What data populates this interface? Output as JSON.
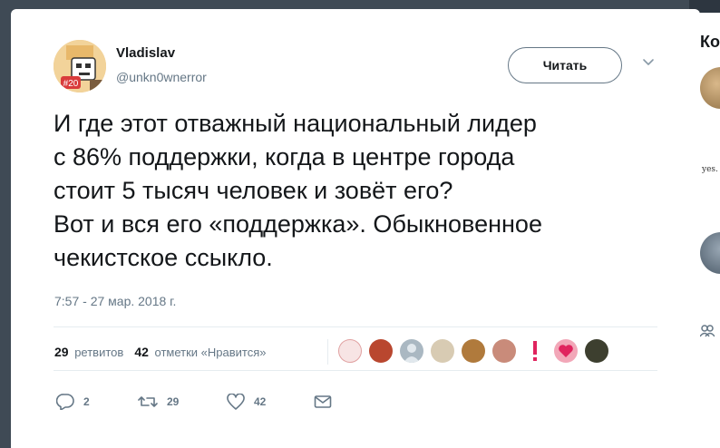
{
  "tweet": {
    "author_name": "Vladislav",
    "author_handle": "@unkn0wnerror",
    "avatar_badge": "#20",
    "follow_label": "Читать",
    "text": "И где этот отважный национальный лидер\nс 86% поддержки, когда в центре города\nстоит 5 тысяч человек и зовёт его?\nВот и вся его «поддержка». Обыкновенное\nчекистское ссыкло.",
    "timestamp": "7:57 - 27 мар. 2018 г.",
    "retweets_count": "29",
    "retweets_label": "ретвитов",
    "likes_count": "42",
    "likes_label": "отметки «Нравится»",
    "actions": {
      "reply_count": "2",
      "retweet_count": "29",
      "like_count": "42"
    },
    "liker_colors": [
      "#f3d6d6",
      "#c9523f",
      "#aab8c2",
      "#d8cbb3",
      "#b07a3c",
      "#c98b7a",
      "#e0245e",
      "#e85b7a",
      "#4a4f3a"
    ]
  },
  "sidebar": {
    "title_fragment": "Ко",
    "card_text": "yes."
  },
  "colors": {
    "text_primary": "#14171a",
    "text_secondary": "#657786",
    "divider": "#e6ecf0",
    "accent_red": "#e0245e"
  }
}
